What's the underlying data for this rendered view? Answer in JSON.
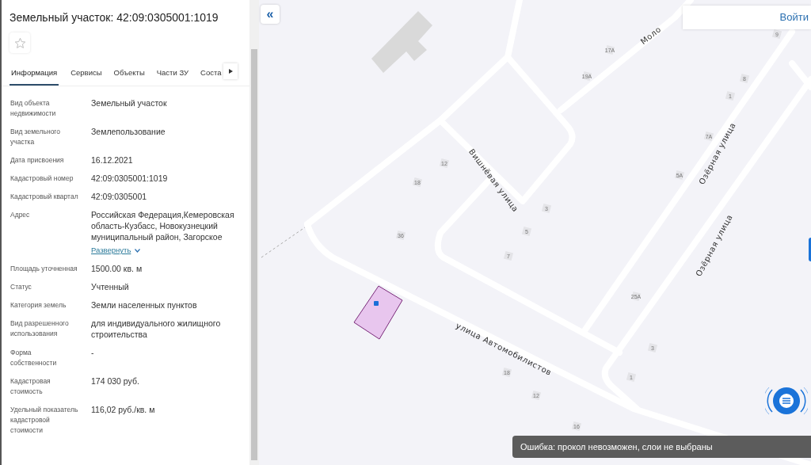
{
  "panel": {
    "title": "Земельный участок: 42:09:0305001:1019",
    "favorite": false,
    "tabs": [
      {
        "label": "Информация",
        "selected": true
      },
      {
        "label": "Сервисы",
        "selected": false
      },
      {
        "label": "Объекты",
        "selected": false
      },
      {
        "label": "Части ЗУ",
        "selected": false
      },
      {
        "label": "Соста",
        "selected": false
      }
    ],
    "properties": [
      {
        "label": "Вид объекта недвижимости",
        "value": "Земельный участок"
      },
      {
        "label": "Вид земельного участка",
        "value": "Землепользование"
      },
      {
        "label": "Дата присвоения",
        "value": "16.12.2021"
      },
      {
        "label": "Кадастровый номер",
        "value": "42:09:0305001:1019"
      },
      {
        "label": "Кадастровый квартал",
        "value": "42:09:0305001"
      },
      {
        "label": "Адрес",
        "value": "Российская Федерация,Кемеровская область-Кузбасс, Новокузнецкий муниципальный район, Загорское",
        "more_link": "Развернуть"
      },
      {
        "label": "Площадь уточненная",
        "value": "1500.00 кв. м"
      },
      {
        "label": "Статус",
        "value": "Учтенный"
      },
      {
        "label": "Категория земель",
        "value": "Земли населенных пунктов"
      },
      {
        "label": "Вид разрешенного использования",
        "value": "для индивидуального жилищного строительства"
      },
      {
        "label": "Форма собственности",
        "value": "-"
      },
      {
        "label": "Кадастровая стоимость",
        "value": "174 030 руб."
      },
      {
        "label": "Удельный показатель кадастровой стоимости",
        "value": "116,02 руб./кв. м"
      }
    ]
  },
  "map": {
    "collapse_button": "«",
    "login_button": "Войти",
    "streets": [
      "Вишнёвая улица",
      "Озёрная улица",
      "Озёрная улица",
      "улица Автомобилистов",
      "Моло"
    ],
    "house_numbers": [
      "17А",
      "19А",
      "9",
      "8",
      "1",
      "7А",
      "5А",
      "12",
      "18",
      "3",
      "36",
      "5",
      "7",
      "25А",
      "3",
      "1",
      "18",
      "12",
      "16"
    ],
    "error_toast": "Ошибка: прокол невозможен, слои не выбраны"
  }
}
